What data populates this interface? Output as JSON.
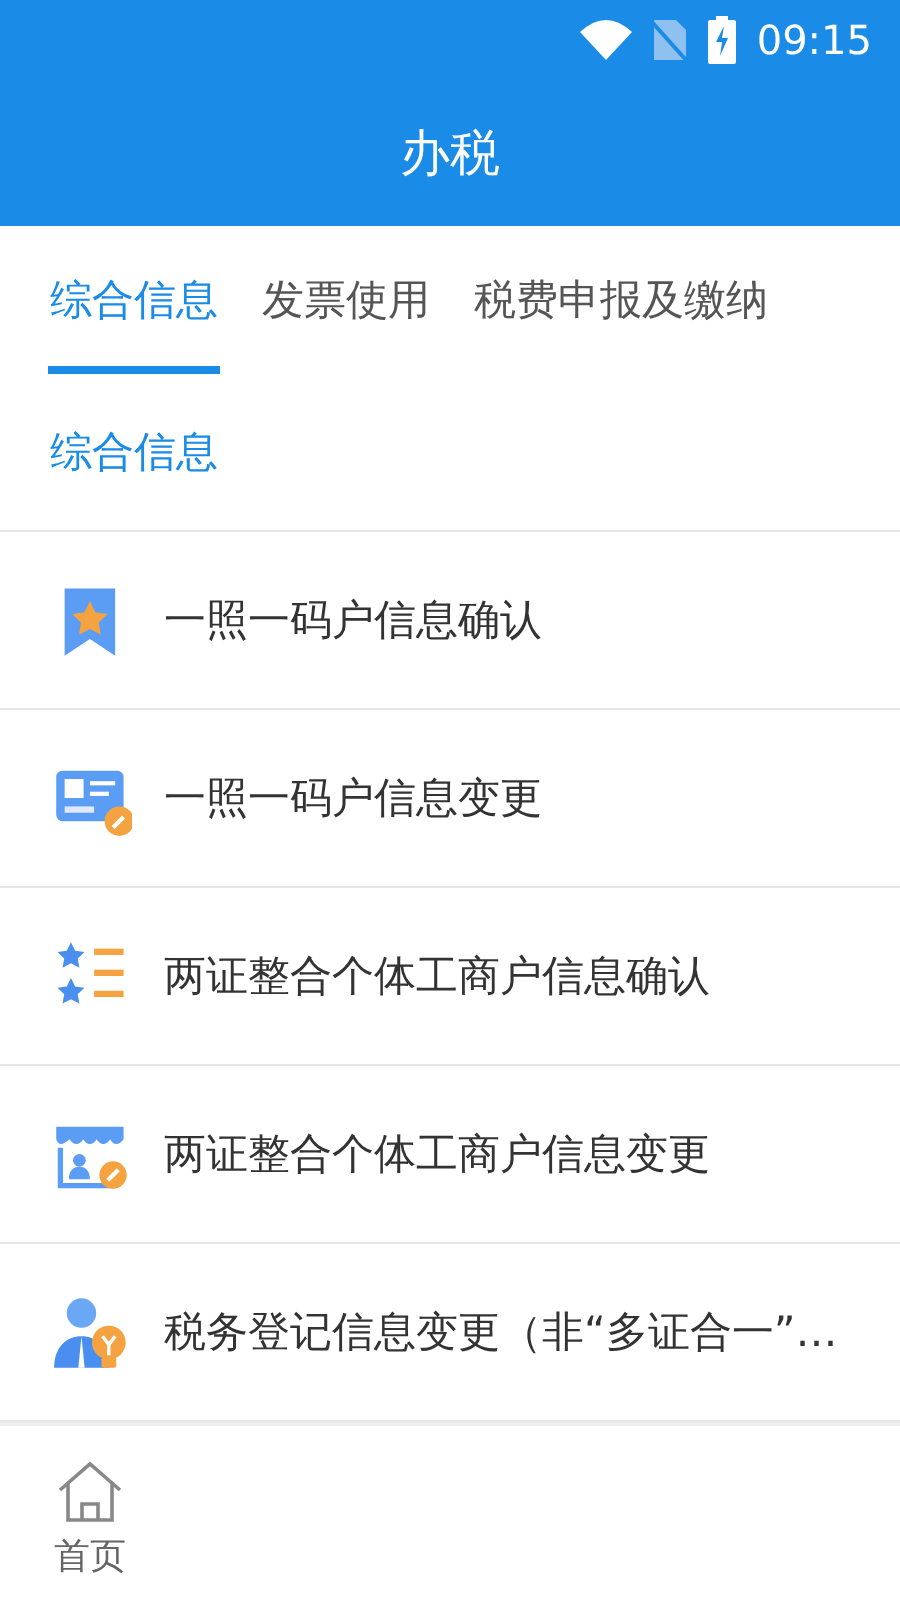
{
  "status_bar": {
    "time": "09:15"
  },
  "header": {
    "title": "办税"
  },
  "tabs": [
    {
      "label": "综合信息",
      "selected": true
    },
    {
      "label": "发票使用",
      "selected": false
    },
    {
      "label": "税费申报及缴纳",
      "selected": false
    }
  ],
  "section": {
    "title": "综合信息"
  },
  "items": [
    {
      "label": "一照一码户信息确认"
    },
    {
      "label": "一照一码户信息变更"
    },
    {
      "label": "两证整合个体工商户信息确认"
    },
    {
      "label": "两证整合个体工商户信息变更"
    },
    {
      "label": "税务登记信息变更（非“多证合一”…"
    }
  ],
  "bottom_nav": [
    {
      "label": "首页"
    }
  ]
}
